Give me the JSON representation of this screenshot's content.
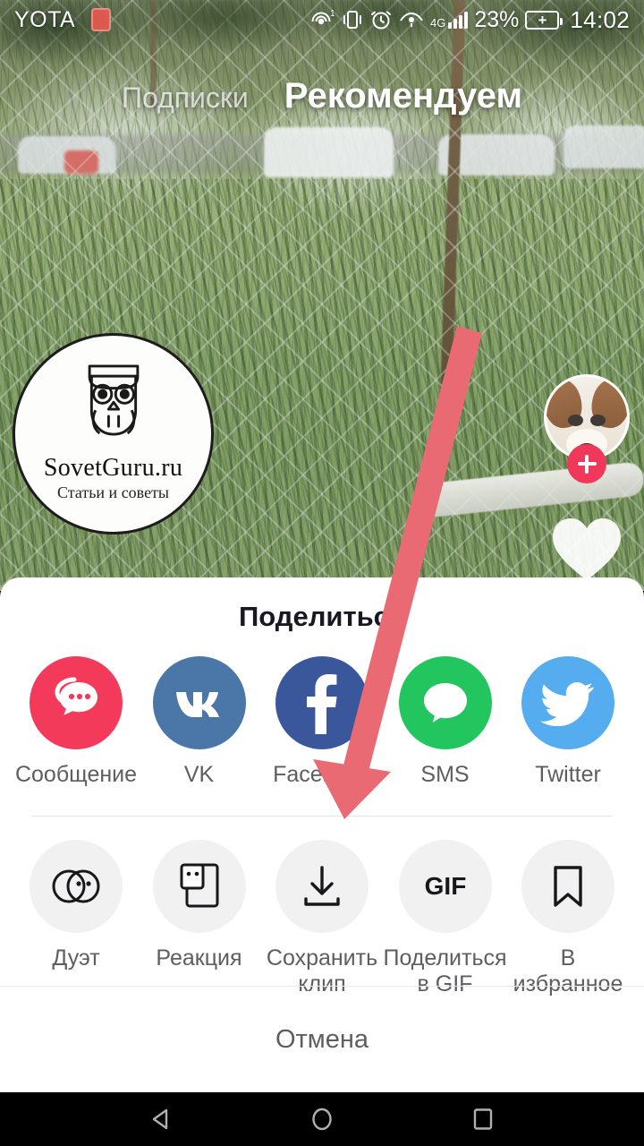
{
  "status_bar": {
    "carrier": "YOTA",
    "sim_icon": "sim-card-icon",
    "icons": [
      "hotspot-icon",
      "vibrate-icon",
      "alarm-icon",
      "eye-comfort-icon"
    ],
    "network_type": "4G",
    "battery_percent": "23%",
    "battery_icon": "battery-charging-icon",
    "time": "14:02"
  },
  "top_tabs": [
    {
      "label": "Подписки",
      "active": false
    },
    {
      "label": "Рекомендуем",
      "active": true
    }
  ],
  "video": {
    "watermark": {
      "logo_icon": "owl-logo-icon",
      "title": "SovetGuru.ru",
      "subtitle": "Статьи и советы"
    },
    "right_rail": {
      "avatar_name": "dog-avatar",
      "follow_label": "+",
      "like_icon": "heart-icon"
    }
  },
  "annotation": {
    "arrow_color": "#ea6a73",
    "points_to": "Сохранить клип"
  },
  "share_sheet": {
    "title": "Поделиться",
    "row1": [
      {
        "label": "Сообщение",
        "icon": "chat-bubbles-icon",
        "color": "#f43a5b"
      },
      {
        "label": "VK",
        "icon": "vk-icon",
        "color": "#4a76a8"
      },
      {
        "label": "Facebook",
        "icon": "facebook-icon",
        "color": "#39579a"
      },
      {
        "label": "SMS",
        "icon": "sms-bubble-icon",
        "color": "#22c55e"
      },
      {
        "label": "Twitter",
        "icon": "twitter-bird-icon",
        "color": "#55acee"
      }
    ],
    "row2": [
      {
        "label": "Дуэт",
        "icon": "duet-circles-icon"
      },
      {
        "label": "Реакция",
        "icon": "reaction-card-icon"
      },
      {
        "label": "Сохранить\nклип",
        "icon": "download-icon"
      },
      {
        "label": "Поделиться\nв GIF",
        "icon": "gif-text-icon"
      },
      {
        "label": "В\nизбранное",
        "icon": "bookmark-icon"
      }
    ],
    "cancel_label": "Отмена"
  },
  "nav_bar": {
    "back_icon": "back-triangle-icon",
    "home_icon": "home-circle-icon",
    "recents_icon": "recents-square-icon"
  }
}
